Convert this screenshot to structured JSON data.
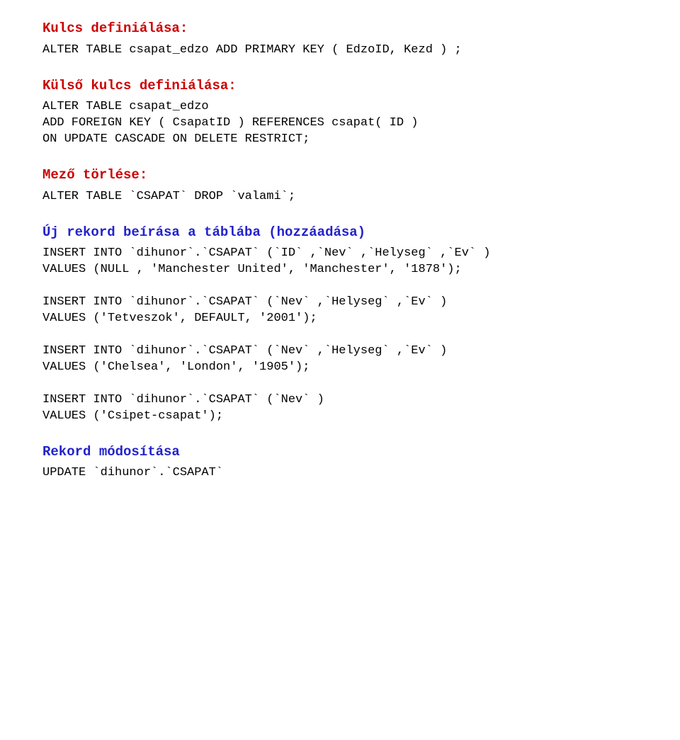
{
  "s1": {
    "heading": "Kulcs definiálása:",
    "text": "ALTER TABLE csapat_edzo ADD PRIMARY KEY ( EdzoID, Kezd ) ;"
  },
  "s2": {
    "heading": "Külső kulcs definiálása:",
    "text": "ALTER TABLE csapat_edzo\nADD FOREIGN KEY ( CsapatID ) REFERENCES csapat( ID )\nON UPDATE CASCADE ON DELETE RESTRICT;"
  },
  "s3": {
    "heading": "Mező törlése:",
    "text": "ALTER TABLE `CSAPAT` DROP `valami`;"
  },
  "s4": {
    "heading": "Új rekord beírása a táblába (hozzáadása)",
    "text": "INSERT INTO `dihunor`.`CSAPAT` (`ID` ,`Nev` ,`Helyseg` ,`Ev` )\nVALUES (NULL , 'Manchester United', 'Manchester', '1878');\n\nINSERT INTO `dihunor`.`CSAPAT` (`Nev` ,`Helyseg` ,`Ev` )\nVALUES ('Tetveszok', DEFAULT, '2001');\n\nINSERT INTO `dihunor`.`CSAPAT` (`Nev` ,`Helyseg` ,`Ev` )\nVALUES ('Chelsea', 'London', '1905');\n\nINSERT INTO `dihunor`.`CSAPAT` (`Nev` )\nVALUES ('Csipet-csapat');"
  },
  "s5": {
    "heading": "Rekord módosítása",
    "text": "UPDATE `dihunor`.`CSAPAT`"
  }
}
